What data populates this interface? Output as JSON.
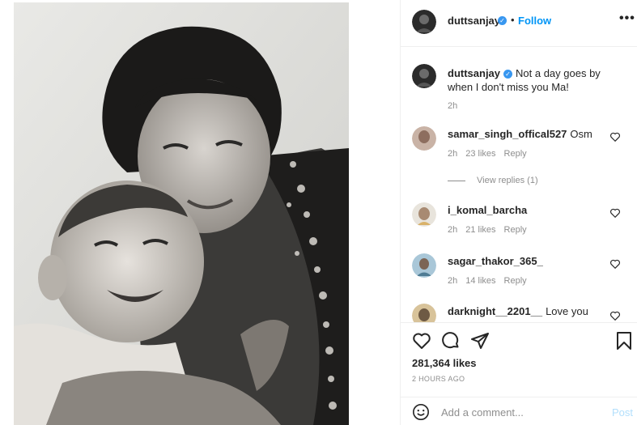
{
  "post": {
    "author": "duttsanjay",
    "follow_label": "Follow",
    "separator": "•",
    "more_label": "•••",
    "verified_mark": "✓",
    "caption": "Not a day goes by when I don't miss you Ma!",
    "caption_time": "2h",
    "likes": "281,364 likes",
    "posted": "2 HOURS AGO"
  },
  "comments": [
    {
      "user": "samar_singh_offical527",
      "text": "Osm",
      "time": "2h",
      "likes": "23 likes",
      "reply": "Reply"
    },
    {
      "user": "i_komal_barcha",
      "text": "",
      "time": "2h",
      "likes": "21 likes",
      "reply": "Reply"
    },
    {
      "user": "sagar_thakor_365_",
      "text": "",
      "time": "2h",
      "likes": "14 likes",
      "reply": "Reply"
    },
    {
      "user": "darknight__2201__",
      "text": "Love you",
      "time": "",
      "likes": "",
      "reply": ""
    }
  ],
  "view_replies": "View replies (1)",
  "composer": {
    "placeholder": "Add a comment...",
    "post_label": "Post"
  },
  "icons": {
    "like": "heart-outline-icon",
    "comment": "comment-bubble-icon",
    "share": "paper-plane-icon",
    "save": "bookmark-icon",
    "emoji": "smiley-icon"
  },
  "colors": {
    "accent": "#0095f6",
    "muted": "#8e8e8e",
    "border": "#efefef",
    "verified": "#3897f0",
    "post_disabled": "#b2dffc"
  }
}
